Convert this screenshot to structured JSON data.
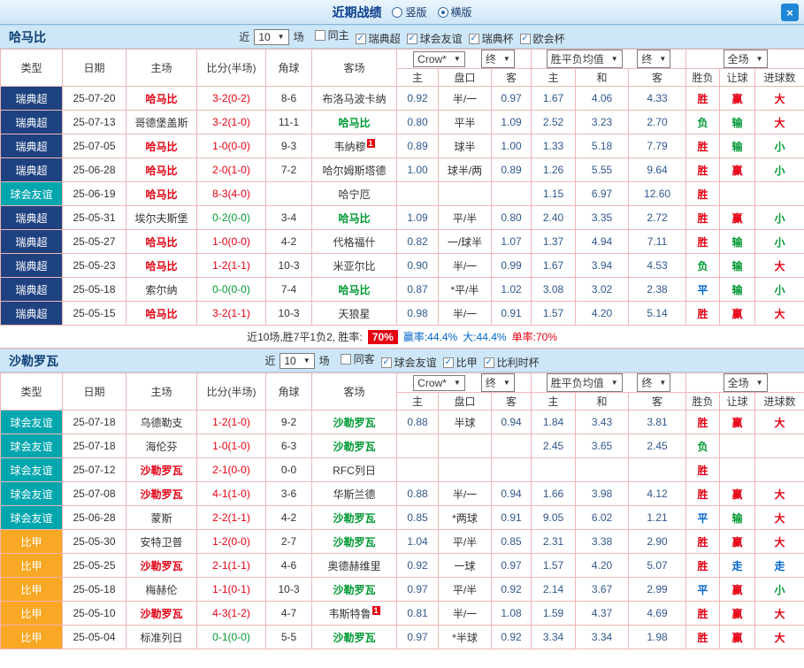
{
  "window": {
    "title": "近期战绩",
    "view_options": [
      {
        "label": "竖版",
        "selected": false
      },
      {
        "label": "横版",
        "selected": true
      }
    ],
    "close": "×"
  },
  "colors": {
    "accent_red": "#e60012",
    "accent_green": "#009933",
    "accent_blue": "#0066cc",
    "league_sweden": "#1e4180",
    "league_friendly": "#00a6ae",
    "league_belgium": "#f9a825",
    "header_blue": "#cde7f8",
    "grid_line": "#f0b6b6"
  },
  "sections": [
    {
      "team": "哈马比",
      "filter": {
        "recent_label": "近",
        "recent_value": "10",
        "matches_label": "场",
        "checks": [
          {
            "label": "同主",
            "checked": false
          },
          {
            "label": "瑞典超",
            "checked": true
          },
          {
            "label": "球会友谊",
            "checked": true
          },
          {
            "label": "瑞典杯",
            "checked": true
          },
          {
            "label": "欧会杯",
            "checked": true
          }
        ]
      },
      "columns": {
        "type": "类型",
        "date": "日期",
        "home": "主场",
        "score": "比分(半场)",
        "corner": "角球",
        "away": "客场",
        "odds_group": {
          "source": "Crow*",
          "final": "终",
          "home": "主",
          "line": "盘口",
          "away": "客"
        },
        "avg_group": {
          "label": "胜平负均值",
          "final": "终",
          "home": "主",
          "draw": "和",
          "away": "客"
        },
        "scope_group": {
          "label": "全场",
          "result": "胜负",
          "handicap": "让球",
          "goals": "进球数"
        }
      },
      "rows": [
        {
          "league": {
            "t": "瑞典超",
            "c": "sw"
          },
          "date": "25-07-20",
          "home": {
            "t": "哈马比",
            "c": "r"
          },
          "score": {
            "t": "3-2(0-2)",
            "c": "r"
          },
          "corner": "8-6",
          "away": {
            "t": "布洛马波卡纳"
          },
          "odds_home": "0.92",
          "odds_line": "半/一",
          "odds_away": "0.97",
          "avg_home": "1.67",
          "avg_draw": "4.06",
          "avg_away": "4.33",
          "result": {
            "t": "胜",
            "c": "r"
          },
          "handicap": {
            "t": "赢",
            "c": "r"
          },
          "goals": {
            "t": "大",
            "c": "r"
          }
        },
        {
          "league": {
            "t": "瑞典超",
            "c": "sw"
          },
          "date": "25-07-13",
          "home": {
            "t": "哥德堡盖斯"
          },
          "score": {
            "t": "3-2(1-0)",
            "c": "r"
          },
          "corner": "11-1",
          "away": {
            "t": "哈马比",
            "c": "g"
          },
          "odds_home": "0.80",
          "odds_line": "平半",
          "odds_away": "1.09",
          "avg_home": "2.52",
          "avg_draw": "3.23",
          "avg_away": "2.70",
          "result": {
            "t": "负",
            "c": "g"
          },
          "handicap": {
            "t": "输",
            "c": "g"
          },
          "goals": {
            "t": "大",
            "c": "r"
          }
        },
        {
          "league": {
            "t": "瑞典超",
            "c": "sw"
          },
          "date": "25-07-05",
          "home": {
            "t": "哈马比",
            "c": "r"
          },
          "score": {
            "t": "1-0(0-0)",
            "c": "r"
          },
          "corner": "9-3",
          "away": {
            "t": "韦纳穆",
            "sup": "1"
          },
          "odds_home": "0.89",
          "odds_line": "球半",
          "odds_away": "1.00",
          "avg_home": "1.33",
          "avg_draw": "5.18",
          "avg_away": "7.79",
          "result": {
            "t": "胜",
            "c": "r"
          },
          "handicap": {
            "t": "输",
            "c": "g"
          },
          "goals": {
            "t": "小",
            "c": "g"
          }
        },
        {
          "league": {
            "t": "瑞典超",
            "c": "sw"
          },
          "date": "25-06-28",
          "home": {
            "t": "哈马比",
            "c": "r"
          },
          "score": {
            "t": "2-0(1-0)",
            "c": "r"
          },
          "corner": "7-2",
          "away": {
            "t": "哈尔姆斯塔德"
          },
          "odds_home": "1.00",
          "odds_line": "球半/两",
          "odds_away": "0.89",
          "avg_home": "1.26",
          "avg_draw": "5.55",
          "avg_away": "9.64",
          "result": {
            "t": "胜",
            "c": "r"
          },
          "handicap": {
            "t": "赢",
            "c": "r"
          },
          "goals": {
            "t": "小",
            "c": "g"
          }
        },
        {
          "league": {
            "t": "球会友谊",
            "c": "fr"
          },
          "date": "25-06-19",
          "home": {
            "t": "哈马比",
            "c": "r"
          },
          "score": {
            "t": "8-3(4-0)",
            "c": "r"
          },
          "corner": "",
          "away": {
            "t": "哈宁厄"
          },
          "odds_home": "",
          "odds_line": "",
          "odds_away": "",
          "avg_home": "1.15",
          "avg_draw": "6.97",
          "avg_away": "12.60",
          "result": {
            "t": "胜",
            "c": "r"
          },
          "handicap": {
            "t": ""
          },
          "goals": {
            "t": ""
          }
        },
        {
          "league": {
            "t": "瑞典超",
            "c": "sw"
          },
          "date": "25-05-31",
          "home": {
            "t": "埃尔夫斯堡"
          },
          "score": {
            "t": "0-2(0-0)",
            "c": "g"
          },
          "corner": "3-4",
          "away": {
            "t": "哈马比",
            "c": "g"
          },
          "odds_home": "1.09",
          "odds_line": "平/半",
          "odds_away": "0.80",
          "avg_home": "2.40",
          "avg_draw": "3.35",
          "avg_away": "2.72",
          "result": {
            "t": "胜",
            "c": "r"
          },
          "handicap": {
            "t": "赢",
            "c": "r"
          },
          "goals": {
            "t": "小",
            "c": "g"
          }
        },
        {
          "league": {
            "t": "瑞典超",
            "c": "sw"
          },
          "date": "25-05-27",
          "home": {
            "t": "哈马比",
            "c": "r"
          },
          "score": {
            "t": "1-0(0-0)",
            "c": "r"
          },
          "corner": "4-2",
          "away": {
            "t": "代格福什"
          },
          "odds_home": "0.82",
          "odds_line": "一/球半",
          "odds_away": "1.07",
          "avg_home": "1.37",
          "avg_draw": "4.94",
          "avg_away": "7.11",
          "result": {
            "t": "胜",
            "c": "r"
          },
          "handicap": {
            "t": "输",
            "c": "g"
          },
          "goals": {
            "t": "小",
            "c": "g"
          }
        },
        {
          "league": {
            "t": "瑞典超",
            "c": "sw"
          },
          "date": "25-05-23",
          "home": {
            "t": "哈马比",
            "c": "r"
          },
          "score": {
            "t": "1-2(1-1)",
            "c": "r"
          },
          "corner": "10-3",
          "away": {
            "t": "米亚尔比"
          },
          "odds_home": "0.90",
          "odds_line": "半/一",
          "odds_away": "0.99",
          "avg_home": "1.67",
          "avg_draw": "3.94",
          "avg_away": "4.53",
          "result": {
            "t": "负",
            "c": "g"
          },
          "handicap": {
            "t": "输",
            "c": "g"
          },
          "goals": {
            "t": "大",
            "c": "r"
          }
        },
        {
          "league": {
            "t": "瑞典超",
            "c": "sw"
          },
          "date": "25-05-18",
          "home": {
            "t": "索尔纳"
          },
          "score": {
            "t": "0-0(0-0)",
            "c": "g"
          },
          "corner": "7-4",
          "away": {
            "t": "哈马比",
            "c": "g"
          },
          "odds_home": "0.87",
          "odds_line": "*平/半",
          "odds_away": "1.02",
          "avg_home": "3.08",
          "avg_draw": "3.02",
          "avg_away": "2.38",
          "result": {
            "t": "平",
            "c": "b"
          },
          "handicap": {
            "t": "输",
            "c": "g"
          },
          "goals": {
            "t": "小",
            "c": "g"
          }
        },
        {
          "league": {
            "t": "瑞典超",
            "c": "sw"
          },
          "date": "25-05-15",
          "home": {
            "t": "哈马比",
            "c": "r"
          },
          "score": {
            "t": "3-2(1-1)",
            "c": "r"
          },
          "corner": "10-3",
          "away": {
            "t": "天狼星"
          },
          "odds_home": "0.98",
          "odds_line": "半/一",
          "odds_away": "0.91",
          "avg_home": "1.57",
          "avg_draw": "4.20",
          "avg_away": "5.14",
          "result": {
            "t": "胜",
            "c": "r"
          },
          "handicap": {
            "t": "赢",
            "c": "r"
          },
          "goals": {
            "t": "大",
            "c": "r"
          }
        }
      ],
      "summary": {
        "prefix": "近10场,胜7平1负2, 胜率:",
        "win_pct": "70%",
        "asian_rate": "赢率:44.4%",
        "big_rate": "大:44.4%",
        "single_rate": "单率:70%"
      }
    },
    {
      "team": "沙勒罗瓦",
      "filter": {
        "recent_label": "近",
        "recent_value": "10",
        "matches_label": "场",
        "checks": [
          {
            "label": "同客",
            "checked": false
          },
          {
            "label": "球会友谊",
            "checked": true
          },
          {
            "label": "比甲",
            "checked": true
          },
          {
            "label": "比利时杯",
            "checked": true
          }
        ]
      },
      "columns": {
        "type": "类型",
        "date": "日期",
        "home": "主场",
        "score": "比分(半场)",
        "corner": "角球",
        "away": "客场",
        "odds_group": {
          "source": "Crow*",
          "final": "终",
          "home": "主",
          "line": "盘口",
          "away": "客"
        },
        "avg_group": {
          "label": "胜平负均值",
          "final": "终",
          "home": "主",
          "draw": "和",
          "away": "客"
        },
        "scope_group": {
          "label": "全场",
          "result": "胜负",
          "handicap": "让球",
          "goals": "进球数"
        }
      },
      "rows": [
        {
          "league": {
            "t": "球会友谊",
            "c": "fr"
          },
          "date": "25-07-18",
          "home": {
            "t": "乌德勒支"
          },
          "score": {
            "t": "1-2(1-0)",
            "c": "r"
          },
          "corner": "9-2",
          "away": {
            "t": "沙勒罗瓦",
            "c": "g"
          },
          "odds_home": "0.88",
          "odds_line": "半球",
          "odds_away": "0.94",
          "avg_home": "1.84",
          "avg_draw": "3.43",
          "avg_away": "3.81",
          "result": {
            "t": "胜",
            "c": "r"
          },
          "handicap": {
            "t": "赢",
            "c": "r"
          },
          "goals": {
            "t": "大",
            "c": "r"
          }
        },
        {
          "league": {
            "t": "球会友谊",
            "c": "fr"
          },
          "date": "25-07-18",
          "home": {
            "t": "海伦芬"
          },
          "score": {
            "t": "1-0(1-0)",
            "c": "r"
          },
          "corner": "6-3",
          "away": {
            "t": "沙勒罗瓦",
            "c": "g"
          },
          "odds_home": "",
          "odds_line": "",
          "odds_away": "",
          "avg_home": "2.45",
          "avg_draw": "3.65",
          "avg_away": "2.45",
          "result": {
            "t": "负",
            "c": "g"
          },
          "handicap": {
            "t": ""
          },
          "goals": {
            "t": ""
          }
        },
        {
          "league": {
            "t": "球会友谊",
            "c": "fr"
          },
          "date": "25-07-12",
          "home": {
            "t": "沙勒罗瓦",
            "c": "r"
          },
          "score": {
            "t": "2-1(0-0)",
            "c": "r"
          },
          "corner": "0-0",
          "away": {
            "t": "RFC列日"
          },
          "odds_home": "",
          "odds_line": "",
          "odds_away": "",
          "avg_home": "",
          "avg_draw": "",
          "avg_away": "",
          "result": {
            "t": "胜",
            "c": "r"
          },
          "handicap": {
            "t": ""
          },
          "goals": {
            "t": ""
          }
        },
        {
          "league": {
            "t": "球会友谊",
            "c": "fr"
          },
          "date": "25-07-08",
          "home": {
            "t": "沙勒罗瓦",
            "c": "r"
          },
          "score": {
            "t": "4-1(1-0)",
            "c": "r"
          },
          "corner": "3-6",
          "away": {
            "t": "华斯兰德"
          },
          "odds_home": "0.88",
          "odds_line": "半/一",
          "odds_away": "0.94",
          "avg_home": "1.66",
          "avg_draw": "3.98",
          "avg_away": "4.12",
          "result": {
            "t": "胜",
            "c": "r"
          },
          "handicap": {
            "t": "赢",
            "c": "r"
          },
          "goals": {
            "t": "大",
            "c": "r"
          }
        },
        {
          "league": {
            "t": "球会友谊",
            "c": "fr"
          },
          "date": "25-06-28",
          "home": {
            "t": "蒙斯"
          },
          "score": {
            "t": "2-2(1-1)",
            "c": "r"
          },
          "corner": "4-2",
          "away": {
            "t": "沙勒罗瓦",
            "c": "g"
          },
          "odds_home": "0.85",
          "odds_line": "*两球",
          "odds_away": "0.91",
          "avg_home": "9.05",
          "avg_draw": "6.02",
          "avg_away": "1.21",
          "result": {
            "t": "平",
            "c": "b"
          },
          "handicap": {
            "t": "输",
            "c": "g"
          },
          "goals": {
            "t": "大",
            "c": "r"
          }
        },
        {
          "league": {
            "t": "比甲",
            "c": "bj"
          },
          "date": "25-05-30",
          "home": {
            "t": "安特卫普"
          },
          "score": {
            "t": "1-2(0-0)",
            "c": "r"
          },
          "corner": "2-7",
          "away": {
            "t": "沙勒罗瓦",
            "c": "g"
          },
          "odds_home": "1.04",
          "odds_line": "平/半",
          "odds_away": "0.85",
          "avg_home": "2.31",
          "avg_draw": "3.38",
          "avg_away": "2.90",
          "result": {
            "t": "胜",
            "c": "r"
          },
          "handicap": {
            "t": "赢",
            "c": "r"
          },
          "goals": {
            "t": "大",
            "c": "r"
          }
        },
        {
          "league": {
            "t": "比甲",
            "c": "bj"
          },
          "date": "25-05-25",
          "home": {
            "t": "沙勒罗瓦",
            "c": "r"
          },
          "score": {
            "t": "2-1(1-1)",
            "c": "r"
          },
          "corner": "4-6",
          "away": {
            "t": "奥德赫维里"
          },
          "odds_home": "0.92",
          "odds_line": "一球",
          "odds_away": "0.97",
          "avg_home": "1.57",
          "avg_draw": "4.20",
          "avg_away": "5.07",
          "result": {
            "t": "胜",
            "c": "r"
          },
          "handicap": {
            "t": "走",
            "c": "b"
          },
          "goals": {
            "t": "走",
            "c": "b"
          }
        },
        {
          "league": {
            "t": "比甲",
            "c": "bj"
          },
          "date": "25-05-18",
          "home": {
            "t": "梅赫伦"
          },
          "score": {
            "t": "1-1(0-1)",
            "c": "r"
          },
          "corner": "10-3",
          "away": {
            "t": "沙勒罗瓦",
            "c": "g"
          },
          "odds_home": "0.97",
          "odds_line": "平/半",
          "odds_away": "0.92",
          "avg_home": "2.14",
          "avg_draw": "3.67",
          "avg_away": "2.99",
          "result": {
            "t": "平",
            "c": "b"
          },
          "handicap": {
            "t": "赢",
            "c": "r"
          },
          "goals": {
            "t": "小",
            "c": "g"
          }
        },
        {
          "league": {
            "t": "比甲",
            "c": "bj"
          },
          "date": "25-05-10",
          "home": {
            "t": "沙勒罗瓦",
            "c": "r"
          },
          "score": {
            "t": "4-3(1-2)",
            "c": "r"
          },
          "corner": "4-7",
          "away": {
            "t": "韦斯特鲁",
            "sup": "1"
          },
          "odds_home": "0.81",
          "odds_line": "半/一",
          "odds_away": "1.08",
          "avg_home": "1.59",
          "avg_draw": "4.37",
          "avg_away": "4.69",
          "result": {
            "t": "胜",
            "c": "r"
          },
          "handicap": {
            "t": "赢",
            "c": "r"
          },
          "goals": {
            "t": "大",
            "c": "r"
          }
        },
        {
          "league": {
            "t": "比甲",
            "c": "bj"
          },
          "date": "25-05-04",
          "home": {
            "t": "标准列日"
          },
          "score": {
            "t": "0-1(0-0)",
            "c": "g"
          },
          "corner": "5-5",
          "away": {
            "t": "沙勒罗瓦",
            "c": "g"
          },
          "odds_home": "0.97",
          "odds_line": "*半球",
          "odds_away": "0.92",
          "avg_home": "3.34",
          "avg_draw": "3.34",
          "avg_away": "1.98",
          "result": {
            "t": "胜",
            "c": "r"
          },
          "handicap": {
            "t": "赢",
            "c": "r"
          },
          "goals": {
            "t": "大",
            "c": "r"
          }
        }
      ]
    }
  ]
}
